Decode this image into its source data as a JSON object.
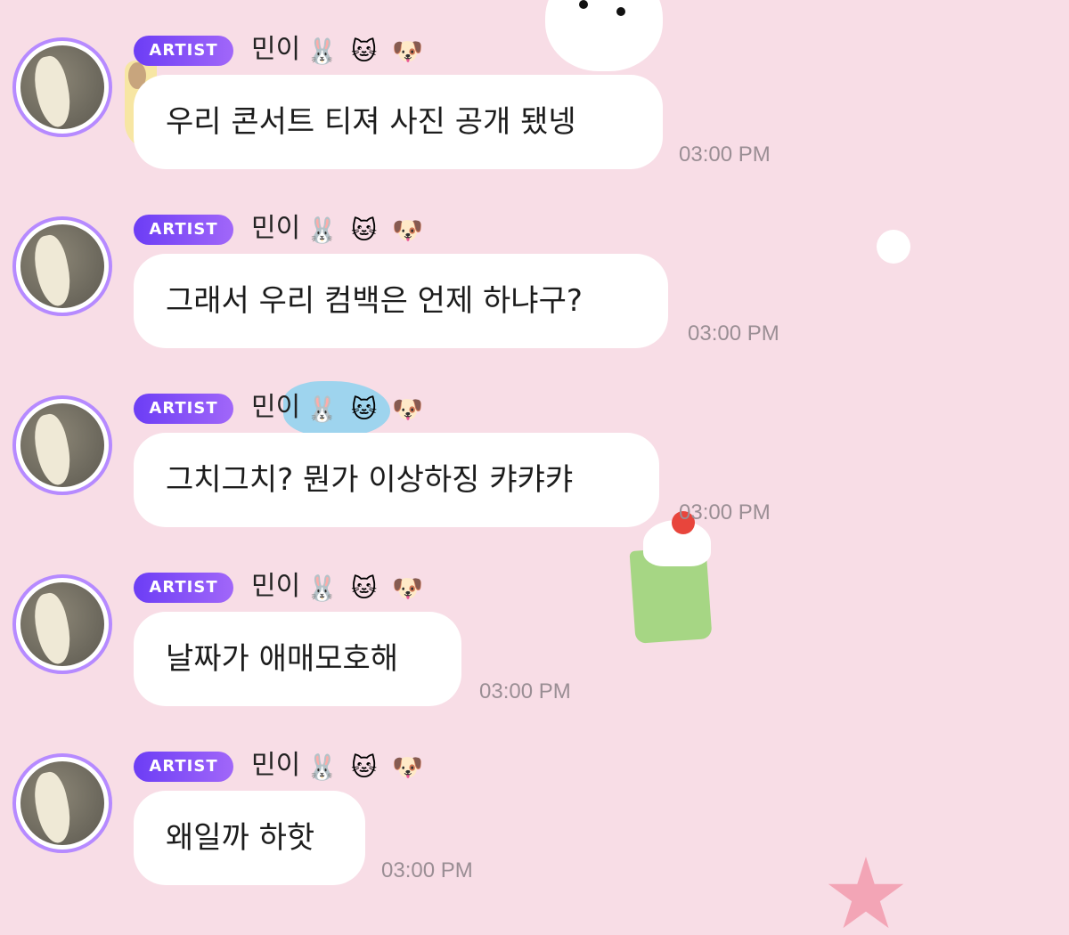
{
  "messages": [
    {
      "badge": "ARTIST",
      "name": "민이",
      "emojis": [
        "🐰",
        "🐱",
        "🐶"
      ],
      "text": "우리 콘서트 티져 사진 공개 됐넹",
      "time": "03:00 PM"
    },
    {
      "badge": "ARTIST",
      "name": "민이",
      "emojis": [
        "🐰",
        "🐱",
        "🐶"
      ],
      "text": "그래서 우리 컴백은 언제 하냐구?",
      "time": "03:00 PM"
    },
    {
      "badge": "ARTIST",
      "name": "민이",
      "emojis": [
        "🐰",
        "🐱",
        "🐶"
      ],
      "text": "그치그치? 뭔가 이상하징 캬캬캬",
      "time": "03:00 PM"
    },
    {
      "badge": "ARTIST",
      "name": "민이",
      "emojis": [
        "🐰",
        "🐱",
        "🐶"
      ],
      "text": "날짜가 애매모호해",
      "time": "03:00 PM"
    },
    {
      "badge": "ARTIST",
      "name": "민이",
      "emojis": [
        "🐰",
        "🐱",
        "🐶"
      ],
      "text": "왜일까 하핫",
      "time": "03:00 PM"
    }
  ],
  "colors": {
    "background": "#f8dde6",
    "badge_start": "#6c3df5",
    "badge_end": "#a167f9",
    "avatar_ring": "#b68aff",
    "time_text": "#9a8e94"
  }
}
